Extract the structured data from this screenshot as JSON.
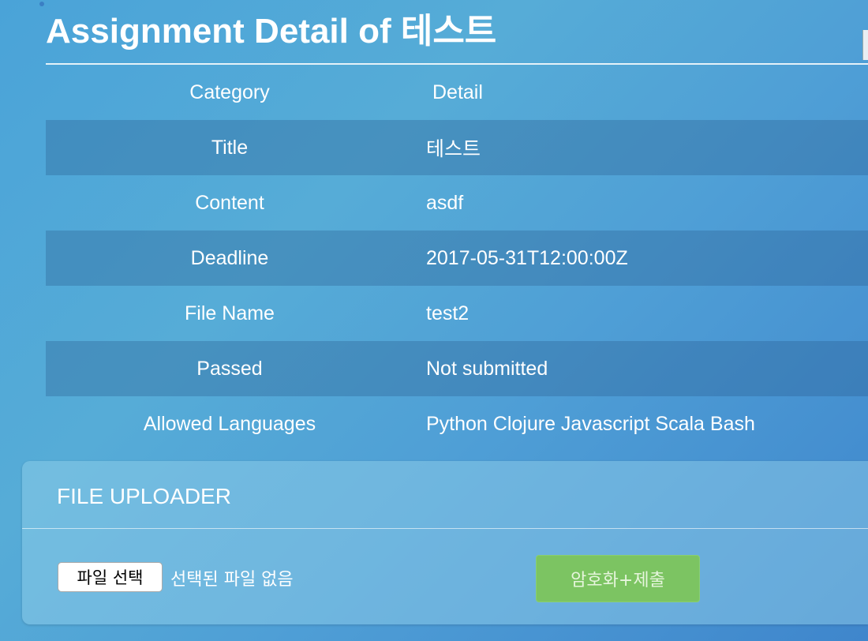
{
  "page": {
    "title": "Assignment Detail of 테스트"
  },
  "table": {
    "headers": {
      "category": "Category",
      "detail": "Detail"
    },
    "rows": [
      {
        "category": "Title",
        "detail": "테스트"
      },
      {
        "category": "Content",
        "detail": "asdf"
      },
      {
        "category": "Deadline",
        "detail": "2017-05-31T12:00:00Z"
      },
      {
        "category": "File Name",
        "detail": "test2"
      },
      {
        "category": "Passed",
        "detail": "Not submitted"
      },
      {
        "category": "Allowed Languages",
        "detail": "Python Clojure Javascript Scala Bash"
      }
    ]
  },
  "uploader": {
    "title": "FILE UPLOADER",
    "file_button_label": "파일 선택",
    "file_status": "선택된 파일 없음",
    "submit_label": "암호화+제출"
  },
  "colors": {
    "submit_button": "#7cc462",
    "background": "#4aa3d8"
  }
}
